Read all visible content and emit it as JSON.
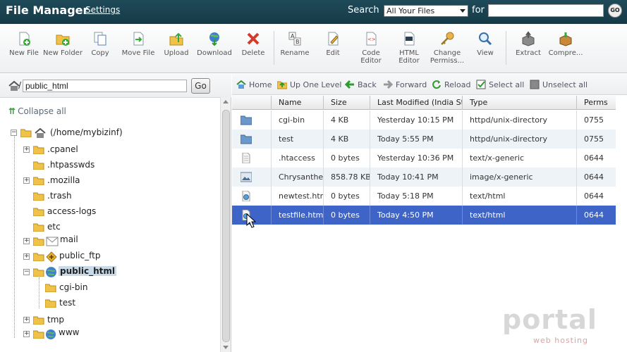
{
  "header": {
    "title": "File Manager",
    "settings_label": "Settings",
    "search_label": "Search",
    "search_scope": "All Your Files",
    "for_label": "for",
    "search_value": "",
    "go_label": "GO"
  },
  "toolbar": {
    "items": [
      {
        "label": "New File",
        "icon": "new-file-icon"
      },
      {
        "label": "New Folder",
        "icon": "new-folder-icon"
      },
      {
        "label": "Copy",
        "icon": "copy-icon"
      },
      {
        "label": "Move File",
        "icon": "move-file-icon"
      },
      {
        "label": "Upload",
        "icon": "upload-icon"
      },
      {
        "label": "Download",
        "icon": "download-icon"
      },
      {
        "label": "Delete",
        "icon": "delete-icon"
      },
      {
        "label": "Rename",
        "icon": "rename-icon"
      },
      {
        "label": "Edit",
        "icon": "edit-icon"
      },
      {
        "label": "Code Editor",
        "icon": "code-editor-icon"
      },
      {
        "label": "HTML Editor",
        "icon": "html-editor-icon"
      },
      {
        "label": "Change Permiss...",
        "icon": "key-icon"
      },
      {
        "label": "View",
        "icon": "view-icon"
      },
      {
        "label": "Extract",
        "icon": "extract-icon"
      },
      {
        "label": "Compre...",
        "icon": "compress-icon"
      }
    ]
  },
  "left": {
    "path_slash": "/",
    "path_value": "public_html",
    "go_label": "Go",
    "collapse_all": "Collapse all",
    "root": "(/home/mybizinf)",
    "tree": [
      ".cpanel",
      ".htpasswds",
      ".mozilla",
      ".trash",
      "access-logs",
      "etc",
      "mail",
      "public_ftp",
      "public_html",
      "cgi-bin",
      "test",
      "tmp",
      "www"
    ]
  },
  "nav": {
    "home": "Home",
    "up": "Up One Level",
    "back": "Back",
    "forward": "Forward",
    "reload": "Reload",
    "select_all": "Select all",
    "unselect_all": "Unselect all"
  },
  "table": {
    "headers": [
      "Name",
      "Size",
      "Last Modified (India Standard Time)",
      "Type",
      "Perms"
    ],
    "rows": [
      {
        "name": "cgi-bin",
        "size": "4 KB",
        "modified": "Yesterday 10:15 PM",
        "type": "httpd/unix-directory",
        "perms": "0755",
        "icon": "folder-icon"
      },
      {
        "name": "test",
        "size": "4 KB",
        "modified": "Today 5:55 PM",
        "type": "httpd/unix-directory",
        "perms": "0755",
        "icon": "folder-icon"
      },
      {
        "name": ".htaccess",
        "size": "0 bytes",
        "modified": "Yesterday 10:36 PM",
        "type": "text/x-generic",
        "perms": "0644",
        "icon": "text-file-icon"
      },
      {
        "name": "Chrysanthemum.jpg",
        "size": "858.78 KB",
        "modified": "Today 10:41 PM",
        "type": "image/x-generic",
        "perms": "0644",
        "icon": "image-file-icon"
      },
      {
        "name": "newtest.html",
        "size": "0 bytes",
        "modified": "Today 5:18 PM",
        "type": "text/html",
        "perms": "0644",
        "icon": "html-file-icon"
      },
      {
        "name": "testfile.html",
        "size": "0 bytes",
        "modified": "Today 4:50 PM",
        "type": "text/html",
        "perms": "0644",
        "icon": "html-file-icon"
      }
    ]
  },
  "watermark": {
    "word": "portal",
    "sub": "web hosting"
  },
  "colors": {
    "header_bg": "#1f4a59",
    "selected_row": "#3d64c6",
    "alt_row": "#eef3f8"
  }
}
